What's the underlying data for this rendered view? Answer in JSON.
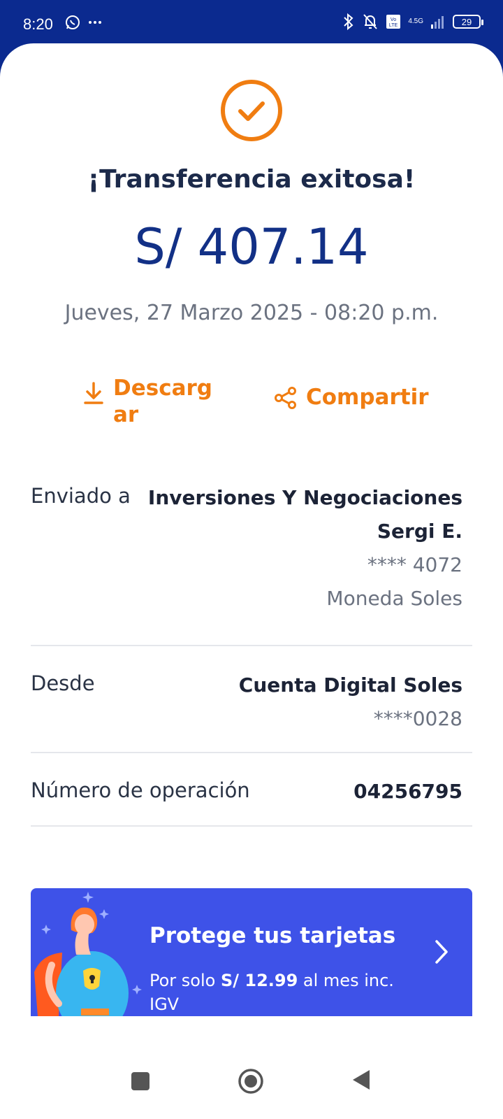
{
  "status_bar": {
    "time": "8:20",
    "network": "4.5G",
    "battery": "29",
    "icons": [
      "whatsapp-icon",
      "more-icon",
      "bluetooth-icon",
      "bell-off-icon",
      "volte-icon",
      "signal-icon",
      "battery-icon"
    ]
  },
  "receipt": {
    "title": "¡Transferencia exitosa!",
    "amount": "S/ 407.14",
    "date": "Jueves, 27 Marzo 2025 - 08:20 p.m."
  },
  "actions": {
    "download_label": "Descargar",
    "share_label": "Compartir"
  },
  "details": {
    "sent_to": {
      "label": "Enviado a",
      "name_line1": "Inversiones Y Negociaciones",
      "name_line2": "Sergi E.",
      "account": "**** 4072",
      "currency": "Moneda Soles"
    },
    "from": {
      "label": "Desde",
      "account_name": "Cuenta Digital Soles",
      "account": "****0028"
    },
    "operation": {
      "label": "Número de operación",
      "number": "04256795"
    }
  },
  "promo": {
    "title": "Protege tus tarjetas",
    "sub_prefix": "Por solo ",
    "sub_price": "S/ 12.99",
    "sub_suffix": " al mes inc. IGV"
  },
  "colors": {
    "header_blue": "#0b2a8f",
    "accent_orange": "#f07d11",
    "amount_blue": "#123086",
    "promo_blue": "#3e52e8"
  }
}
